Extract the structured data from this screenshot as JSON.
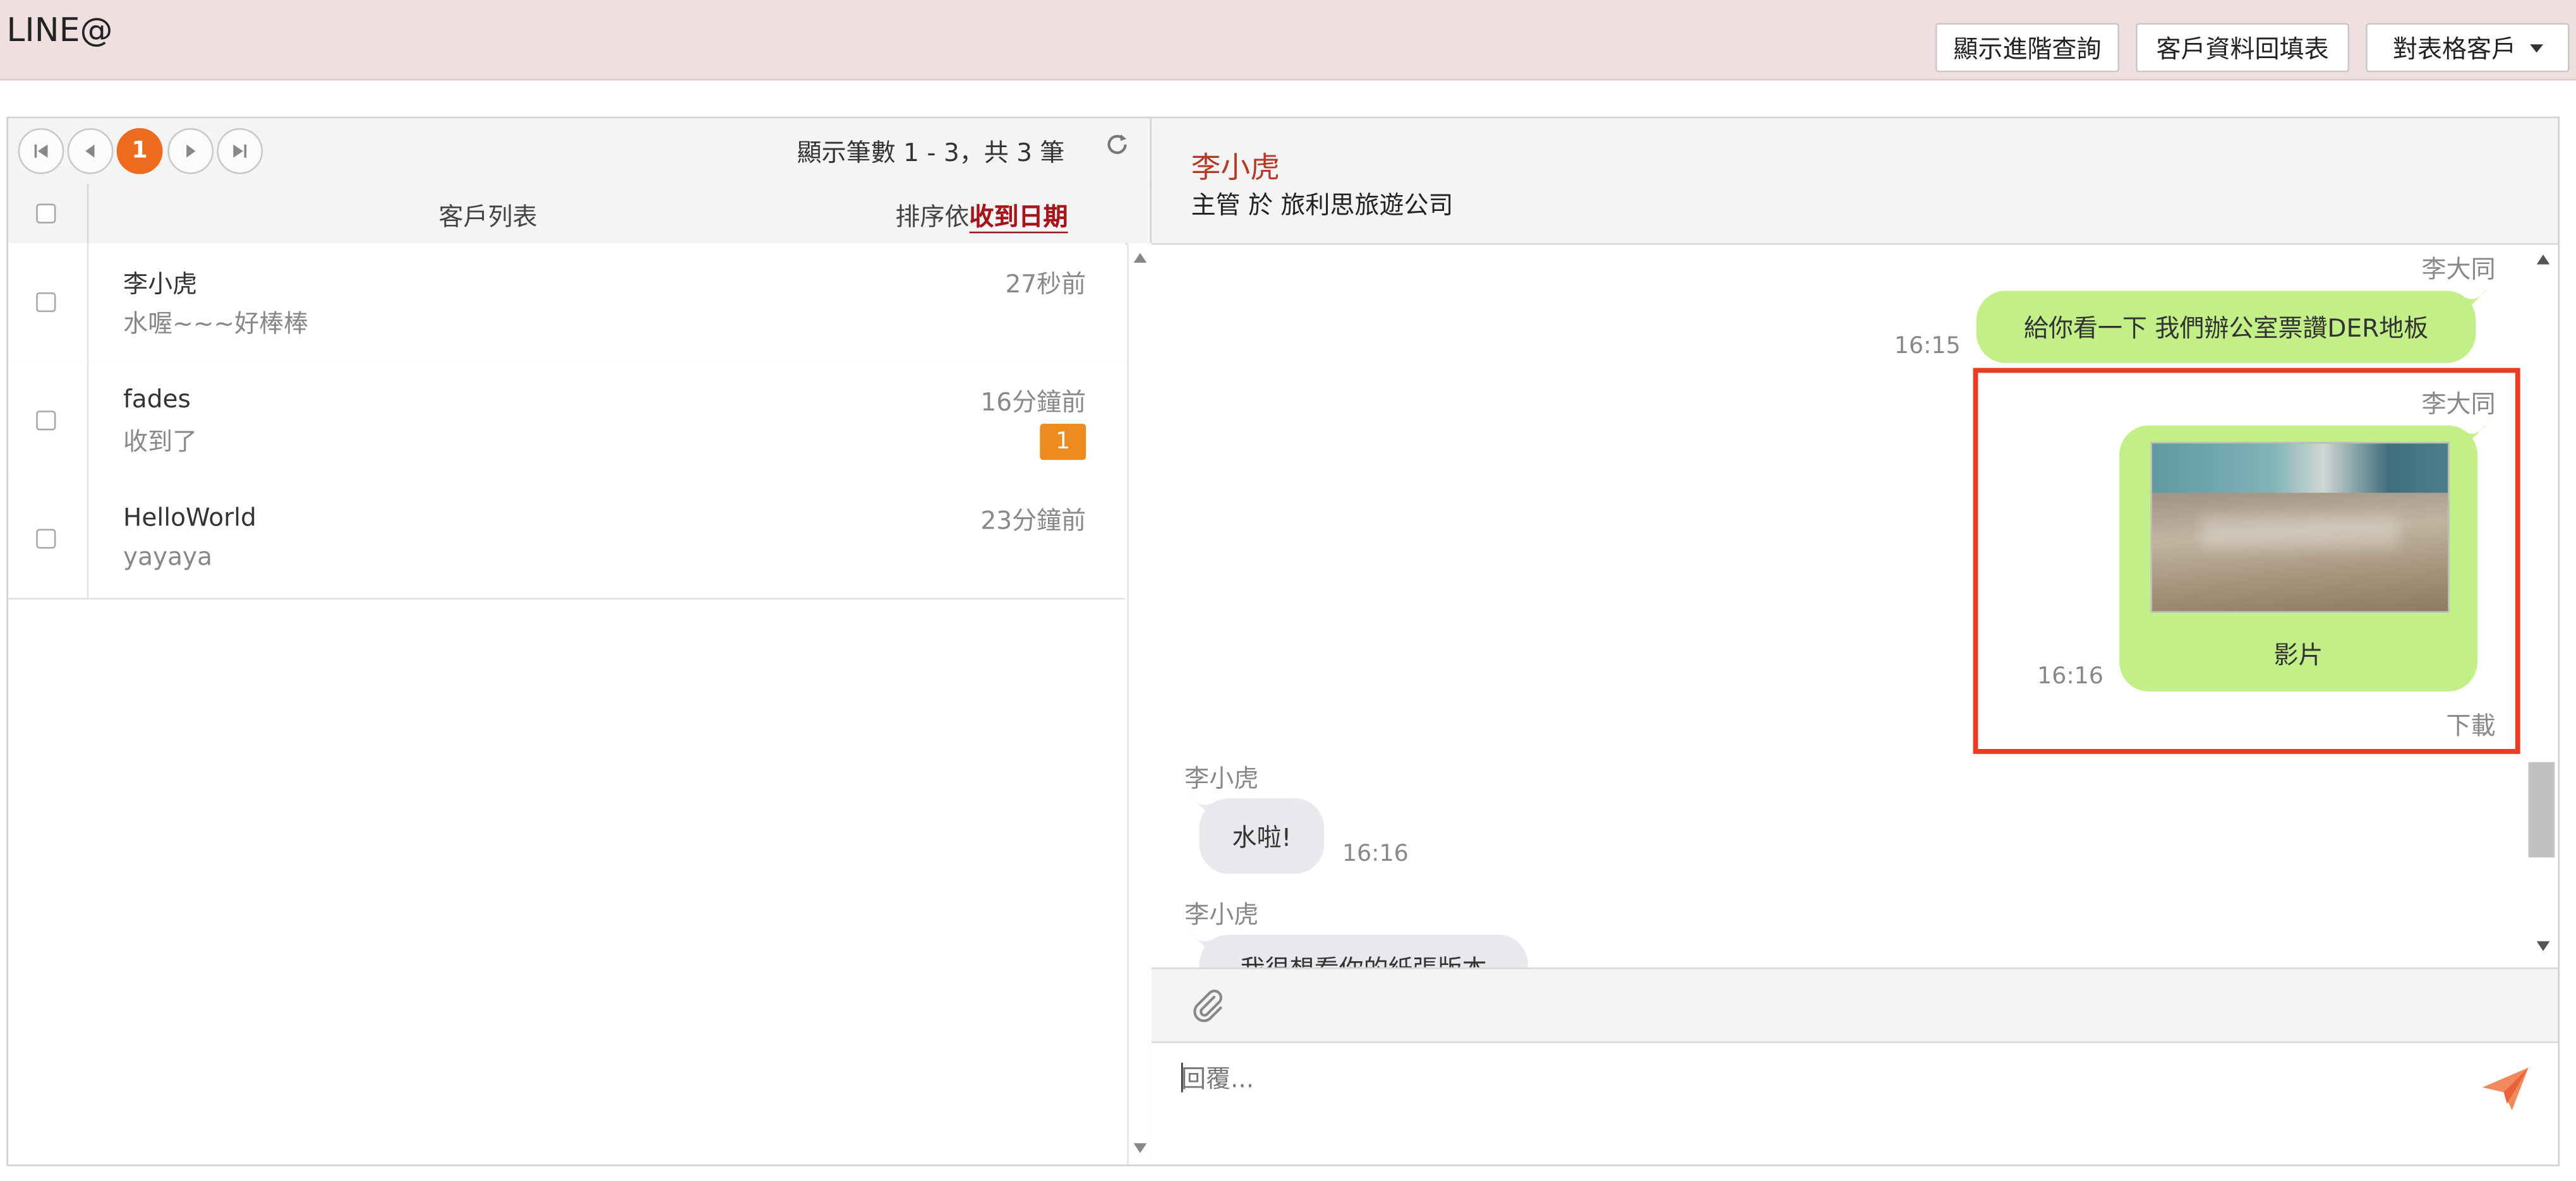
{
  "header": {
    "brand": "LINE@",
    "btn_advanced_query": "顯示進階查詢",
    "btn_customer_form": "客戶資料回填表",
    "btn_customer_filter": "對表格客戶"
  },
  "pager": {
    "current_page": "1",
    "info": "顯示筆數 1 - 3，共 3 筆"
  },
  "list": {
    "title": "客戶列表",
    "sort_prefix": "排序依",
    "sort_field": "收到日期",
    "rows": [
      {
        "name": "李小虎",
        "preview": "水喔~~~好棒棒",
        "time": "27秒前",
        "badge": ""
      },
      {
        "name": "fades",
        "preview": "收到了",
        "time": "16分鐘前",
        "badge": "1"
      },
      {
        "name": "HelloWorld",
        "preview": "yayaya",
        "time": "23分鐘前",
        "badge": ""
      }
    ]
  },
  "chat": {
    "contact_name": "李小虎",
    "contact_info": "主管 於 旅利思旅遊公司",
    "messages": [
      {
        "sender": "李大同",
        "text": "給你看一下 我們辦公室票讚DER地板",
        "time": "16:15"
      },
      {
        "sender": "李大同",
        "text": "影片",
        "time": "16:16",
        "download": "下載"
      },
      {
        "sender": "李小虎",
        "text": "水啦!",
        "time": "16:16"
      },
      {
        "sender": "李小虎",
        "text": "我很想看你的紙張版本"
      }
    ],
    "reply_placeholder": "回覆..."
  },
  "colors": {
    "header_bg": "#f0dfe0",
    "accent_orange": "#ee6b1e",
    "badge_orange": "#ee8a1e",
    "sort_red": "#a3161c",
    "contact_red": "#b33a26",
    "bubble_green": "#c3ef89",
    "bubble_gray": "#e7e9ec",
    "highlight_red": "#ea3b24"
  }
}
